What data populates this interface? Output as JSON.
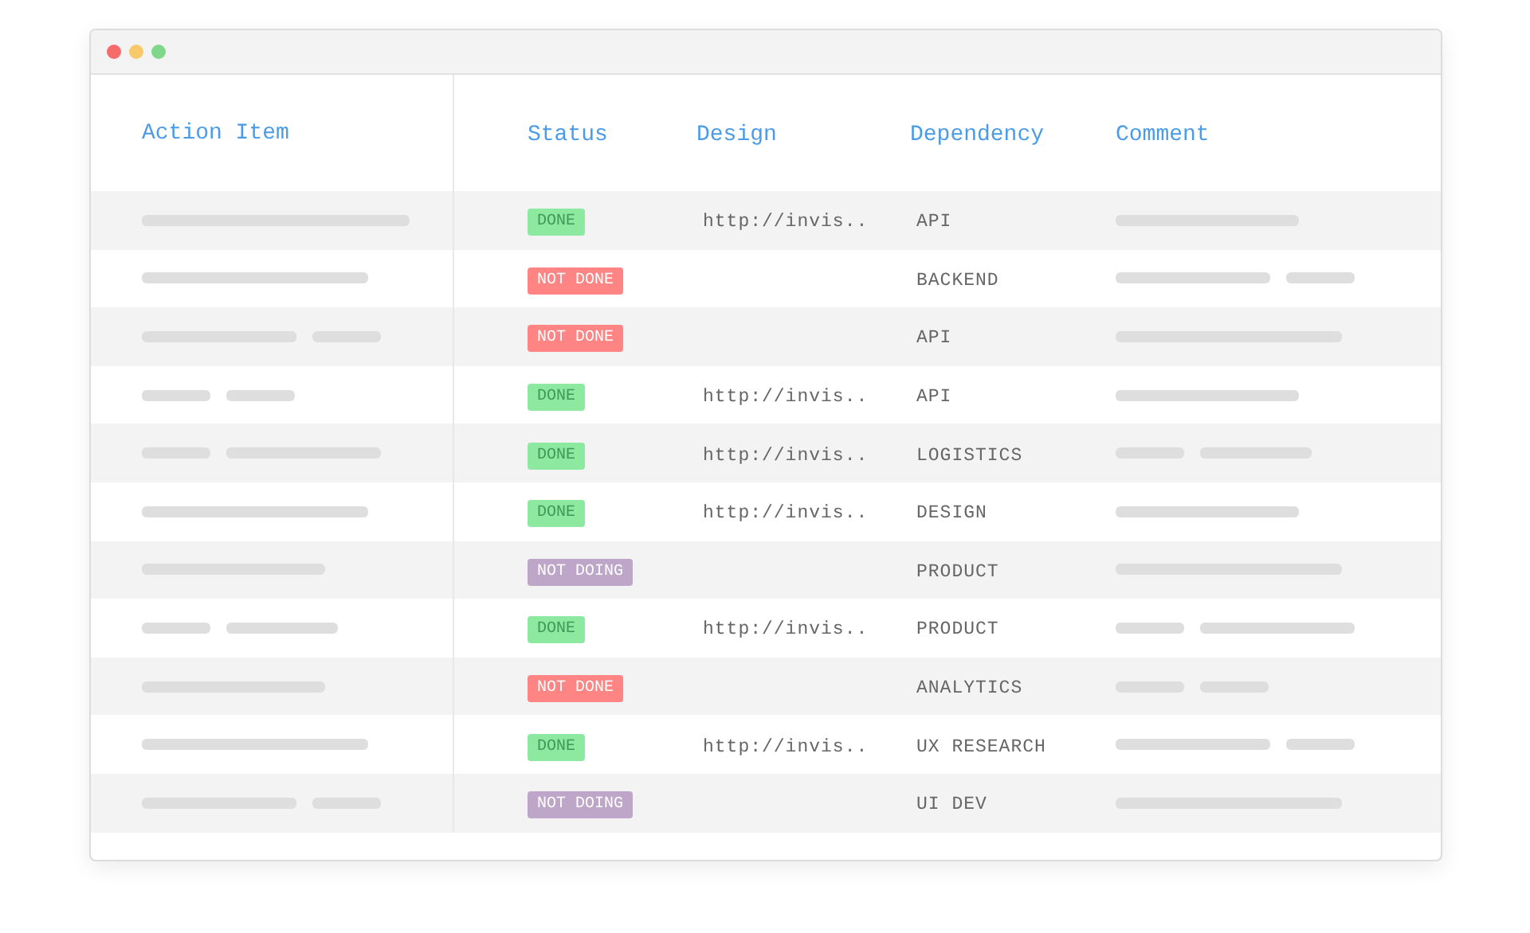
{
  "table": {
    "columns": [
      "Action Item",
      "Status",
      "Design",
      "Dependency",
      "Comment"
    ],
    "rows": [
      {
        "status": {
          "text": "DONE",
          "kind": "done"
        },
        "design": "http://invis..",
        "dependency": "API"
      },
      {
        "status": {
          "text": "NOT DONE",
          "kind": "not_done"
        },
        "dependency": "BACKEND"
      },
      {
        "status": {
          "text": "NOT DONE",
          "kind": "not_done"
        },
        "dependency": "API"
      },
      {
        "status": {
          "text": "DONE",
          "kind": "done"
        },
        "design": "http://invis..",
        "dependency": "API"
      },
      {
        "status": {
          "text": "DONE",
          "kind": "done"
        },
        "design": "http://invis..",
        "dependency": "LOGISTICS"
      },
      {
        "status": {
          "text": "DONE",
          "kind": "done"
        },
        "design": "http://invis..",
        "dependency": "DESIGN"
      },
      {
        "status": {
          "text": "NOT DOING",
          "kind": "not_doing"
        },
        "dependency": "PRODUCT"
      },
      {
        "status": {
          "text": "DONE",
          "kind": "done"
        },
        "design": "http://invis..",
        "dependency": "PRODUCT"
      },
      {
        "status": {
          "text": "NOT DONE",
          "kind": "not_done"
        },
        "dependency": "ANALYTICS"
      },
      {
        "status": {
          "text": "DONE",
          "kind": "done"
        },
        "design": "http://invis..",
        "dependency": "UX RESEARCH"
      },
      {
        "status": {
          "text": "NOT DOING",
          "kind": "not_doing"
        },
        "dependency": "UI DEV"
      }
    ]
  }
}
